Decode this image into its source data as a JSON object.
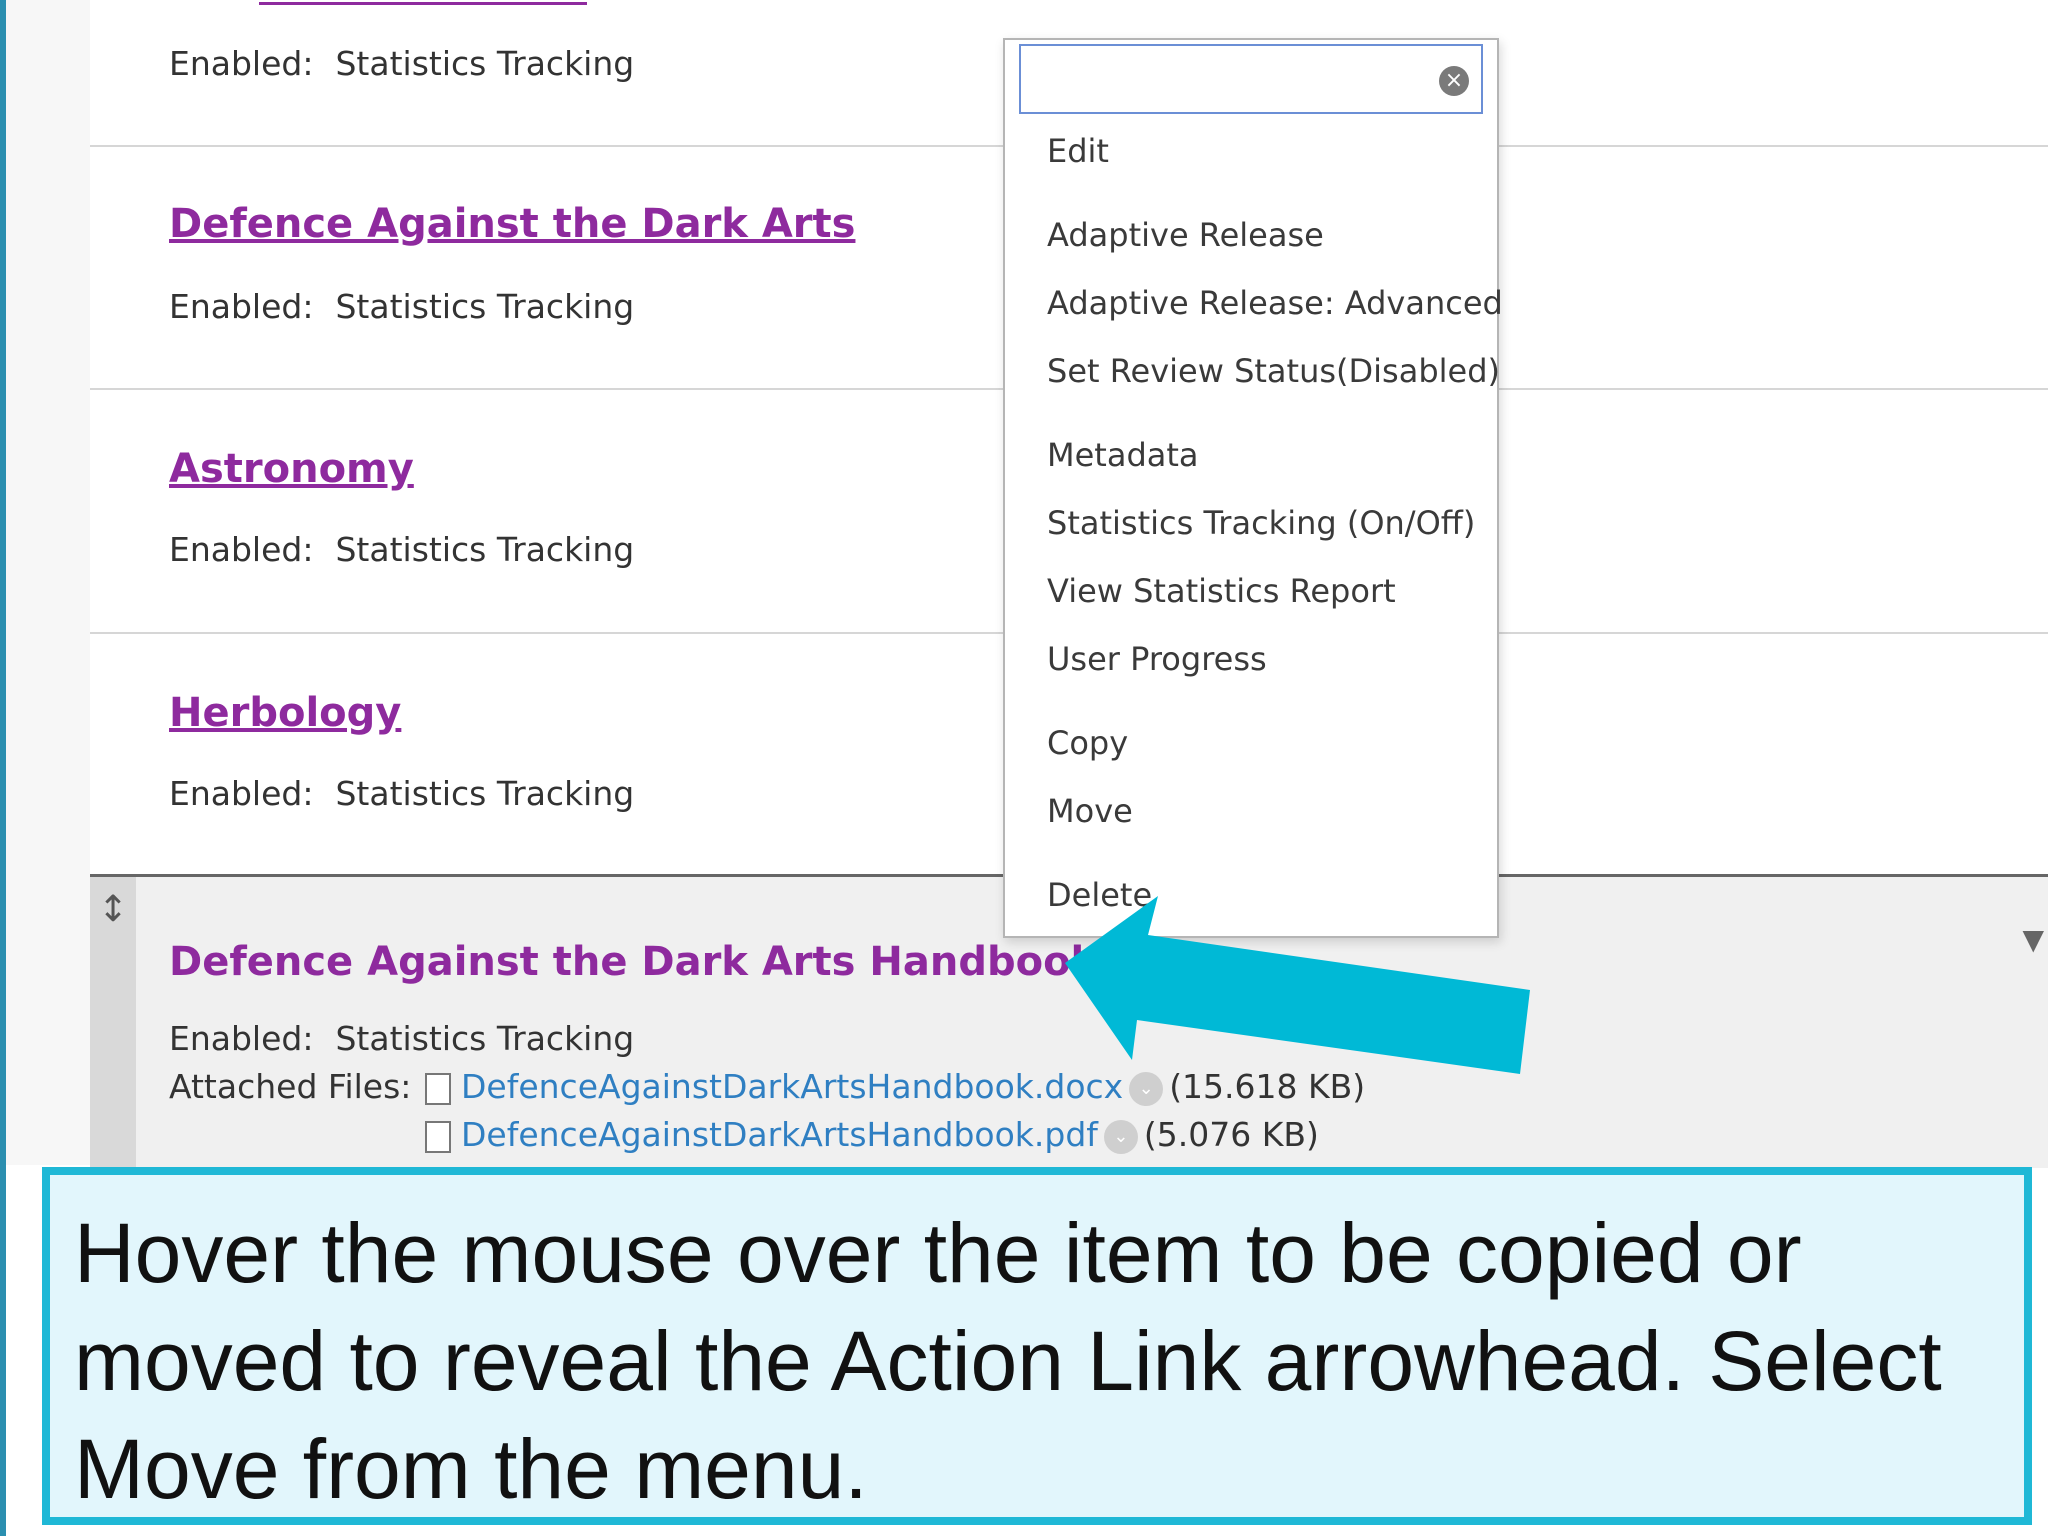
{
  "items": [
    {
      "title": "",
      "enabled_label": "Enabled:",
      "enabled_value": "Statistics Tracking"
    },
    {
      "title": "Defence Against the Dark Arts",
      "enabled_label": "Enabled:",
      "enabled_value": "Statistics Tracking"
    },
    {
      "title": "Astronomy",
      "enabled_label": "Enabled:",
      "enabled_value": "Statistics Tracking"
    },
    {
      "title": "Herbology",
      "enabled_label": "Enabled:",
      "enabled_value": "Statistics Tracking"
    }
  ],
  "selected_item": {
    "title": "Defence Against the Dark Arts Handbook",
    "enabled_label": "Enabled:",
    "enabled_value": "Statistics Tracking",
    "attached_label": "Attached Files:",
    "files": [
      {
        "name": "DefenceAgainstDarkArtsHandbook.docx",
        "size": "(15.618 KB)"
      },
      {
        "name": "DefenceAgainstDarkArtsHandbook.pdf",
        "size": "(5.076 KB)"
      }
    ]
  },
  "menu": {
    "search_value": "",
    "items": [
      "Edit",
      "Adaptive Release",
      "Adaptive Release: Advanced",
      "Set Review Status(Disabled)",
      "Metadata",
      "Statistics Tracking (On/Off)",
      "View Statistics Report",
      "User Progress",
      "Copy",
      "Move",
      "Delete"
    ]
  },
  "callout": {
    "text": "Hover the mouse over the item to be copied or moved to reveal the Action Link arrowhead. Select Move from the menu."
  },
  "colors": {
    "link_purple": "#8e2a9e",
    "file_blue": "#2f7fc2",
    "arrow_cyan": "#00b9d6",
    "callout_bg": "#e2f6fc",
    "callout_border": "#1fb8d6"
  },
  "icons": [
    "drag-handle-icon",
    "chevron-down-icon",
    "file-icon",
    "clear-icon",
    "caret-down-icon"
  ]
}
